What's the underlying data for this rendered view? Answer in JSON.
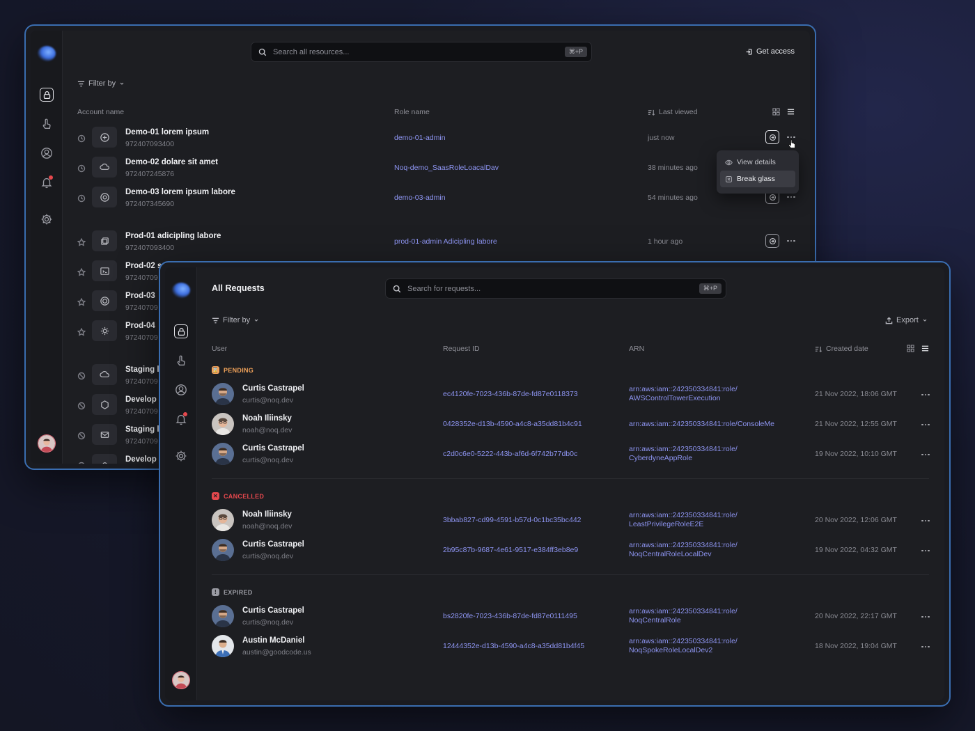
{
  "back_window": {
    "search_placeholder": "Search all resources...",
    "search_shortcut": "⌘+P",
    "get_access_label": "Get access",
    "filter_label": "Filter by",
    "columns": {
      "account": "Account name",
      "role": "Role name",
      "last_viewed": "Last viewed"
    },
    "rows": [
      {
        "name": "Demo-01 lorem ipsum",
        "id": "972407093400",
        "role": "demo-01-admin",
        "viewed": "just now"
      },
      {
        "name": "Demo-02 dolare sit amet",
        "id": "972407245876",
        "role": "Noq-demo_SaasRoleLoacalDav",
        "viewed": "38 minutes ago"
      },
      {
        "name": "Demo-03 lorem ipsum labore",
        "id": "972407345690",
        "role": "demo-03-admin",
        "viewed": "54 minutes ago"
      },
      {
        "name": "Prod-01 adicipling labore",
        "id": "972407093400",
        "role": "prod-01-admin Adicipling labore",
        "viewed": "1 hour ago"
      },
      {
        "name": "Prod-02 s",
        "id": "97240709",
        "role": "",
        "viewed": ""
      },
      {
        "name": "Prod-03",
        "id": "97240709",
        "role": "",
        "viewed": ""
      },
      {
        "name": "Prod-04",
        "id": "97240709",
        "role": "",
        "viewed": ""
      },
      {
        "name": "Staging l",
        "id": "97240709",
        "role": "",
        "viewed": ""
      },
      {
        "name": "Develop",
        "id": "97240709",
        "role": "",
        "viewed": ""
      },
      {
        "name": "Staging l",
        "id": "97240709",
        "role": "",
        "viewed": ""
      },
      {
        "name": "Develop",
        "id": "",
        "role": "",
        "viewed": ""
      }
    ],
    "menu": {
      "view_details": "View details",
      "break_glass": "Break glass"
    }
  },
  "front_window": {
    "title": "All Requests",
    "search_placeholder": "Search for requests...",
    "search_shortcut": "⌘+P",
    "filter_label": "Filter by",
    "export_label": "Export",
    "columns": {
      "user": "User",
      "request_id": "Request ID",
      "arn": "ARN",
      "created": "Created date"
    },
    "groups": [
      {
        "label": "PENDING",
        "color": "#f0a25a",
        "badge": "⌛",
        "rows": [
          {
            "name": "Curtis Castrapel",
            "email": "curtis@noq.dev",
            "request_id": "ec4120fe-7023-436b-87de-fd87e0118373",
            "arn1": "arn:aws:iam::242350334841:role/",
            "arn2": "AWSControlTowerExecution",
            "date": "21 Nov 2022, 18:06 GMT",
            "avatar": "curtis"
          },
          {
            "name": "Noah Iliinsky",
            "email": "noah@noq.dev",
            "request_id": "0428352e-d13b-4590-a4c8-a35dd81b4c91",
            "arn1": "arn:aws:iam::242350334841:role/ConsoleMe",
            "arn2": "",
            "date": "21 Nov 2022, 12:55 GMT",
            "avatar": "noah"
          },
          {
            "name": "Curtis Castrapel",
            "email": "curtis@noq.dev",
            "request_id": "c2d0c6e0-5222-443b-af6d-6f742b77db0c",
            "arn1": "arn:aws:iam::242350334841:role/",
            "arn2": "CyberdyneAppRole",
            "date": "19 Nov 2022, 10:10 GMT",
            "avatar": "curtis"
          }
        ]
      },
      {
        "label": "CANCELLED",
        "color": "#e5484d",
        "badge": "✕",
        "rows": [
          {
            "name": "Noah Iliinsky",
            "email": "noah@noq.dev",
            "request_id": "3bbab827-cd99-4591-b57d-0c1bc35bc442",
            "arn1": "arn:aws:iam::242350334841:role/",
            "arn2": "LeastPrivilegeRoleE2E",
            "date": "20 Nov 2022, 12:06 GMT",
            "avatar": "noah"
          },
          {
            "name": "Curtis Castrapel",
            "email": "curtis@noq.dev",
            "request_id": "2b95c87b-9687-4e61-9517-e384ff3eb8e9",
            "arn1": "arn:aws:iam::242350334841:role/",
            "arn2": "NoqCentralRoleLocalDev",
            "date": "19 Nov 2022, 04:32 GMT",
            "avatar": "curtis"
          }
        ]
      },
      {
        "label": "EXPIRED",
        "color": "#9a9ba3",
        "badge": "!",
        "rows": [
          {
            "name": "Curtis Castrapel",
            "email": "curtis@noq.dev",
            "request_id": "bs2820fe-7023-436b-87de-fd87e0111495",
            "arn1": "arn:aws:iam::242350334841:role/",
            "arn2": "NoqCentralRole",
            "date": "20 Nov 2022, 22:17 GMT",
            "avatar": "curtis"
          },
          {
            "name": "Austin McDaniel",
            "email": "austin@goodcode.us",
            "request_id": "12444352e-d13b-4590-a4c8-a35dd81b4f45",
            "arn1": "arn:aws:iam::242350334841:role/",
            "arn2": "NoqSpokeRoleLocalDev2",
            "date": "18 Nov 2022, 19:04 GMT",
            "avatar": "austin"
          }
        ]
      }
    ]
  }
}
